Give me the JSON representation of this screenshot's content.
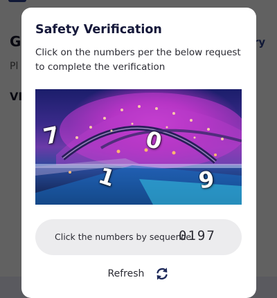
{
  "background": {
    "heading": "G",
    "link": "ry",
    "subtext": "Pl",
    "section": "VI"
  },
  "modal": {
    "title": "Safety Verification",
    "instruction": "Click on the numbers per the below request to complete the verification",
    "captcha": {
      "digits": [
        "7",
        "0",
        "1",
        "9"
      ]
    },
    "sequence": {
      "label": "Click the numbers by sequence:",
      "value": "0197"
    },
    "refresh_label": "Refresh",
    "refresh_icon": "refresh-icon"
  },
  "colors": {
    "title": "#15183a",
    "link": "#2a3f8f",
    "pill": "#ececee"
  }
}
